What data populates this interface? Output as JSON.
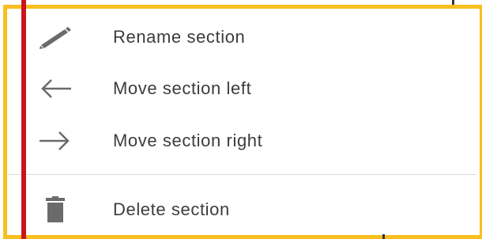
{
  "menu": {
    "items": [
      {
        "label": "Rename section",
        "icon": "pencil-icon"
      },
      {
        "label": "Move section left",
        "icon": "arrow-left-icon"
      },
      {
        "label": "Move section right",
        "icon": "arrow-right-icon"
      },
      {
        "label": "Delete section",
        "icon": "trash-icon"
      }
    ]
  },
  "colors": {
    "highlight": "#f9bf1e",
    "marker": "#c8151c",
    "text": "#3c3c3c",
    "icon": "#6b6b6b",
    "divider": "#dcdcdc"
  }
}
